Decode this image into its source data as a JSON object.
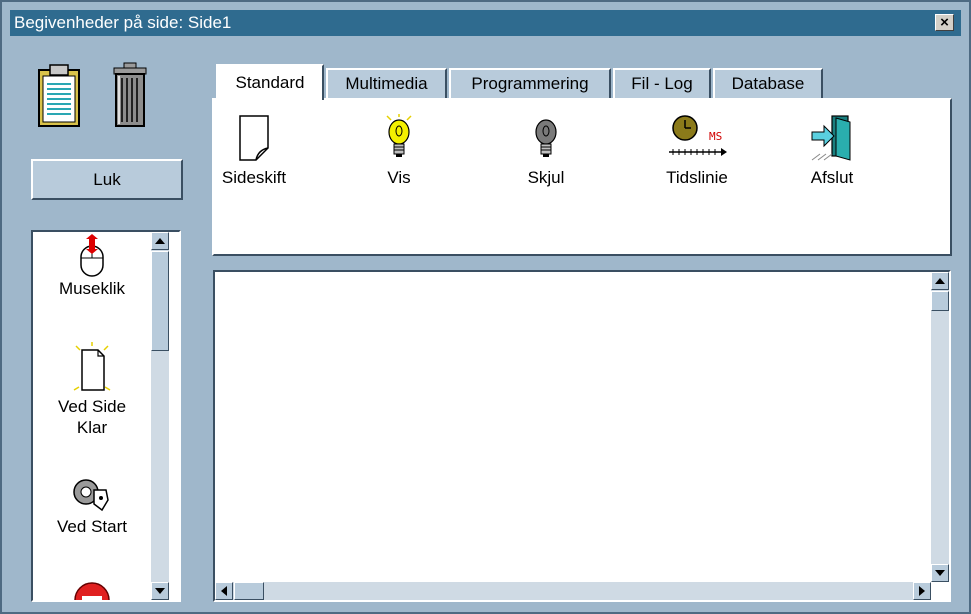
{
  "window": {
    "title": "Begivenheder på side: Side1",
    "close_glyph": "×"
  },
  "toolbar_icons": [
    "clipboard-icon",
    "trash-can-icon"
  ],
  "luk_button": {
    "label": "Luk"
  },
  "events_list": {
    "items": [
      {
        "label": "Museklik",
        "icon": "mouse-click-icon"
      },
      {
        "label": "Ved Side Klar",
        "icon": "page-ready-icon"
      },
      {
        "label": "Ved Start",
        "icon": "start-key-icon"
      },
      {
        "label": "",
        "icon": "stop-sign-icon"
      }
    ],
    "scroll_position": 0.1
  },
  "tabs": [
    {
      "label": "Standard",
      "active": true
    },
    {
      "label": "Multimedia",
      "active": false
    },
    {
      "label": "Programmering",
      "active": false
    },
    {
      "label": "Fil - Log",
      "active": false
    },
    {
      "label": "Database",
      "active": false
    }
  ],
  "tools": [
    {
      "label": "Sideskift",
      "icon": "page-break-icon"
    },
    {
      "label": "Vis",
      "icon": "lightbulb-on-icon"
    },
    {
      "label": "Skjul",
      "icon": "lightbulb-off-icon"
    },
    {
      "label": "Tidslinie",
      "icon": "timeline-clock-icon",
      "icon_text": "MS"
    },
    {
      "label": "Afslut",
      "icon": "exit-door-icon"
    }
  ],
  "colors": {
    "window_bg": "#9fb7cb",
    "titlebar": "#2f6b8f",
    "button_face": "#b8cbdb"
  }
}
